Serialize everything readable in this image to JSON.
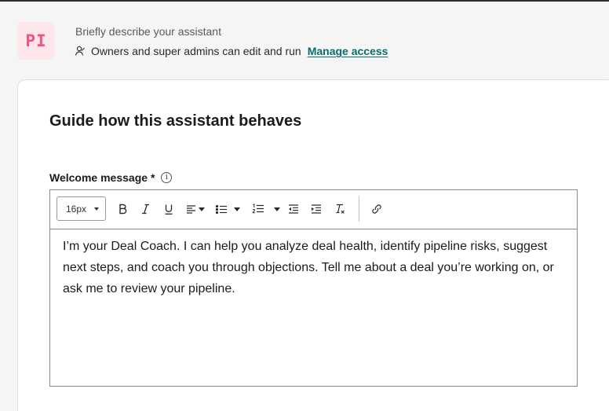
{
  "header": {
    "avatar_initials": "PI",
    "description_placeholder": "Briefly describe your assistant",
    "access_text": "Owners and super admins can edit and run",
    "manage_access_label": "Manage access"
  },
  "section": {
    "title": "Guide how this assistant behaves",
    "welcome_label": "Welcome message",
    "required_marker": "*"
  },
  "editor": {
    "font_size": "16px",
    "toolbar_icons": [
      "bold-icon",
      "italic-icon",
      "underline-icon",
      "align-icon",
      "bullet-list-icon",
      "numbered-list-icon",
      "decrease-indent-icon",
      "increase-indent-icon",
      "clear-format-icon",
      "link-icon"
    ],
    "content": "I’m your Deal Coach. I can help you analyze deal health, identify pipeline risks, suggest next steps, and coach you through objections. Tell me about a deal you’re working on, or ask me to review your pipeline."
  },
  "colors": {
    "avatar_bg": "#fde7ea",
    "avatar_text": "#f2547d",
    "link": "#0b6e6e"
  }
}
